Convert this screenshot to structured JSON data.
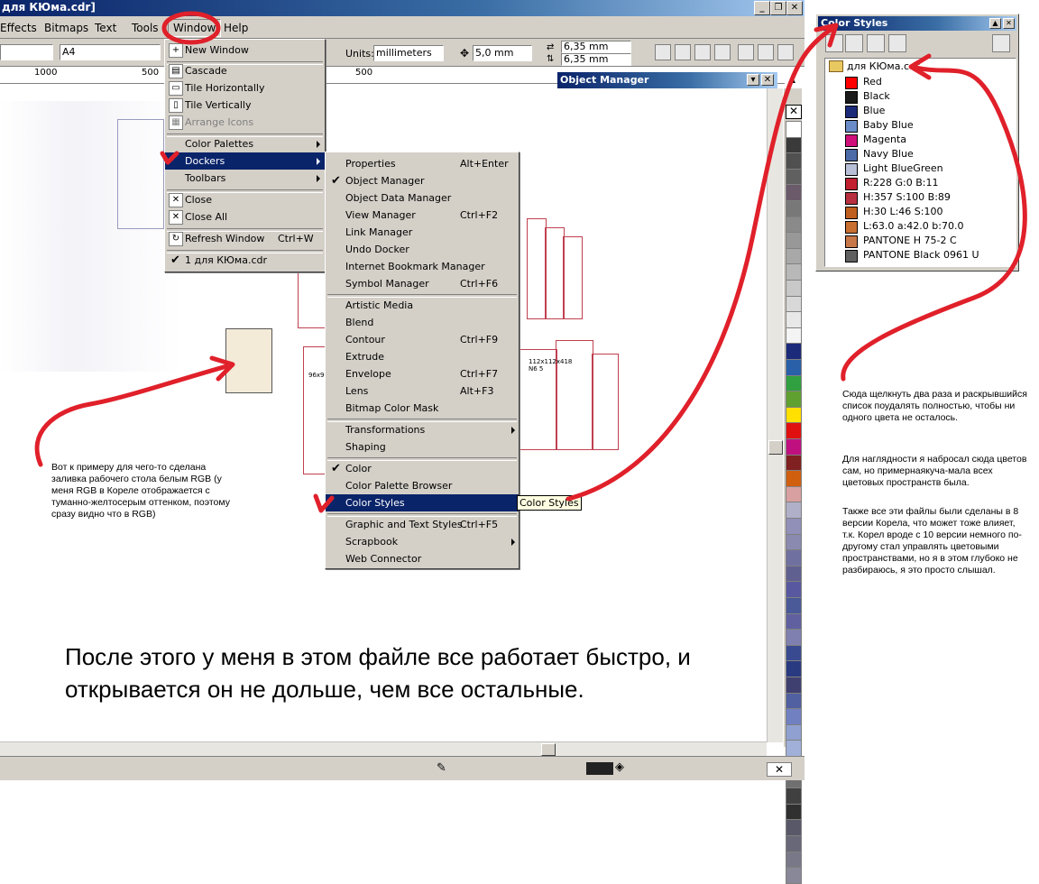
{
  "window": {
    "title": "для КЮма.cdr]"
  },
  "menubar": {
    "effects": "Effects",
    "bitmaps": "Bitmaps",
    "text": "Text",
    "tools": "Tools",
    "window": "Window",
    "help": "Help"
  },
  "propbar": {
    "page_size": "A4",
    "units_label": "Units:",
    "units_value": "millimeters",
    "nudge": "5,0 mm",
    "dup_x": "6,35 mm",
    "dup_y": "6,35 mm"
  },
  "ruler": {
    "t1": "1000",
    "t2": "500",
    "t3": "500"
  },
  "window_menu": {
    "new_window": "New Window",
    "cascade": "Cascade",
    "tile_h": "Tile Horizontally",
    "tile_v": "Tile Vertically",
    "arrange": "Arrange Icons",
    "color_palettes": "Color Palettes",
    "dockers": "Dockers",
    "toolbars": "Toolbars",
    "close": "Close",
    "close_all": "Close All",
    "refresh": "Refresh Window",
    "refresh_sc": "Ctrl+W",
    "doc1": "1 для КЮма.cdr"
  },
  "dockers_menu": [
    {
      "label": "Properties",
      "sc": "Alt+Enter",
      "check": false
    },
    {
      "label": "Object Manager",
      "sc": "",
      "check": true
    },
    {
      "label": "Object Data Manager",
      "sc": "",
      "check": false
    },
    {
      "label": "View Manager",
      "sc": "Ctrl+F2",
      "check": false
    },
    {
      "label": "Link Manager",
      "sc": "",
      "check": false
    },
    {
      "label": "Undo Docker",
      "sc": "",
      "check": false
    },
    {
      "label": "Internet Bookmark Manager",
      "sc": "",
      "check": false
    },
    {
      "label": "Symbol Manager",
      "sc": "Ctrl+F6",
      "check": false
    },
    {
      "label": "Artistic Media",
      "sc": "",
      "check": false
    },
    {
      "label": "Blend",
      "sc": "",
      "check": false
    },
    {
      "label": "Contour",
      "sc": "Ctrl+F9",
      "check": false
    },
    {
      "label": "Extrude",
      "sc": "",
      "check": false
    },
    {
      "label": "Envelope",
      "sc": "Ctrl+F7",
      "check": false
    },
    {
      "label": "Lens",
      "sc": "Alt+F3",
      "check": false
    },
    {
      "label": "Bitmap Color Mask",
      "sc": "",
      "check": false
    },
    {
      "label": "Transformations",
      "sc": "",
      "check": false
    },
    {
      "label": "Shaping",
      "sc": "",
      "check": false
    },
    {
      "label": "Color",
      "sc": "",
      "check": true
    },
    {
      "label": "Color Palette Browser",
      "sc": "",
      "check": false
    },
    {
      "label": "Color Styles",
      "sc": "",
      "check": false
    },
    {
      "label": "Graphic and Text Styles",
      "sc": "Ctrl+F5",
      "check": false
    },
    {
      "label": "Scrapbook",
      "sc": "",
      "check": false
    },
    {
      "label": "Web Connector",
      "sc": "",
      "check": false
    }
  ],
  "tooltip": "Color Styles",
  "object_manager": {
    "title": "Object Manager"
  },
  "color_styles": {
    "title": "Color Styles",
    "folder": "для КЮма.cdr",
    "items": [
      {
        "name": "Red",
        "color": "#ff0000"
      },
      {
        "name": "Black",
        "color": "#1a1a1a"
      },
      {
        "name": "Blue",
        "color": "#1c2a7a"
      },
      {
        "name": "Baby Blue",
        "color": "#6a8cc8"
      },
      {
        "name": "Magenta",
        "color": "#d0107a"
      },
      {
        "name": "Navy Blue",
        "color": "#4a6aa8"
      },
      {
        "name": "Light BlueGreen",
        "color": "#b8c0d8"
      },
      {
        "name": "R:228 G:0 B:11",
        "color": "#c02030"
      },
      {
        "name": "H:357 S:100 B:89",
        "color": "#b83040"
      },
      {
        "name": "H:30 L:46 S:100",
        "color": "#c06020"
      },
      {
        "name": "L:63.0 a:42.0 b:70.0",
        "color": "#c87030"
      },
      {
        "name": "PANTONE H 75-2 C",
        "color": "#c87848"
      },
      {
        "name": "PANTONE Black 0961 U",
        "color": "#606060"
      }
    ]
  },
  "palette": [
    "#ffffff",
    "#3a3a3a",
    "#505050",
    "#606060",
    "#6a5a6a",
    "#787878",
    "#8a8a8a",
    "#989898",
    "#a8a8a8",
    "#b8b8b8",
    "#c8c8c8",
    "#d8d8d8",
    "#e8e8e8",
    "#f4f4f4",
    "#1c2a7a",
    "#2a60a8",
    "#30a040",
    "#60a030",
    "#ffe000",
    "#e01010",
    "#c01080",
    "#802020",
    "#d06010",
    "#d8a0a0",
    "#b0b0c8",
    "#9090b8",
    "#8a8ab0",
    "#7070a0",
    "#606090",
    "#5858a0",
    "#4a5a98",
    "#6060a0",
    "#8080b0",
    "#3a4a90",
    "#2a3a80",
    "#404070",
    "#5060a0",
    "#7080c0",
    "#90a0d0",
    "#a0b0d8",
    "#606060",
    "#707070",
    "#404040",
    "#303030",
    "#585868",
    "#686878",
    "#787888",
    "#888898"
  ],
  "notes": {
    "left": "Вот к примеру для чего-то сделана заливка рабочего стола белым RGB (у меня RGB в Кореле отображается с туманно-желтосерым оттенком, поэтому сразу видно что в RGB)",
    "right1": "Сюда щелкнуть два раза и раскрывшийся список поудалять полностью, чтобы ни одного цвета не осталось.",
    "right2": "Для наглядности я набросал сюда цветов сам, но примернаякуча-мала всех цветовых пространств была.",
    "right3": "Также все эти файлы были сделаны в 8 версии Корела, что может тоже влияет, т.к. Корел вроде с 10 версии немного по-другому стал управлять цветовыми пространствами, но я в этом глубоко не разбираюсь, я это просто слышал.",
    "big": "После этого у меня в этом файле все работает быстро, и открывается он не дольше, чем все остальные."
  },
  "canvas": {
    "rgb_fill": "#f4ead8",
    "box_label1": "112x112x418\nN6 5",
    "box_label2": "96x96"
  },
  "annotation_color": "#e0202a"
}
